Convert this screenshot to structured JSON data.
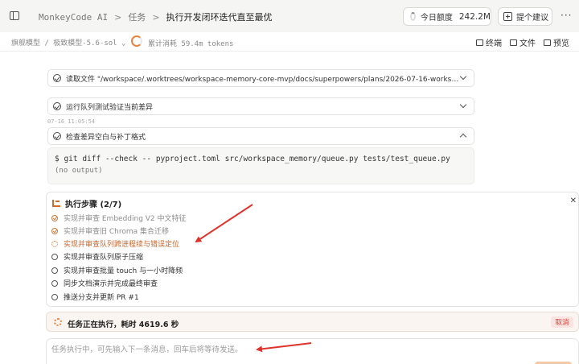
{
  "header": {
    "app_title": "MonkeyCode AI",
    "breadcrumb_section": "任务",
    "breadcrumb_current": "执行开发闭环迭代直至最优",
    "quota_label": "今日额度",
    "quota_value": "242.2M",
    "suggest_label": "提个建议",
    "more_label": "···"
  },
  "subbar": {
    "model_select": "旗舰模型 / 极致模型-5.6-sol ⌄",
    "token_usage": "累计消耗 59.4m tokens",
    "tools": [
      "终端",
      "文件",
      "预览"
    ]
  },
  "tool_cards": [
    {
      "text": "读取文件 \"/workspace/.worktrees/workspace-memory-core-mvp/docs/superpowers/plans/2026-07-16-works…",
      "expanded": false
    },
    {
      "text": "运行队列测试验证当前差异",
      "expanded": false
    },
    {
      "text": "检查差异空白与补丁格式",
      "expanded": true
    }
  ],
  "timestamp": "07-16 11:05:54",
  "output": {
    "command": "$ git diff --check -- pyproject.toml src/workspace_memory/queue.py tests/test_queue.py",
    "result": "(no output)"
  },
  "steps_panel": {
    "title": "执行步骤 (2/7)",
    "close_label": "✕",
    "items": [
      {
        "label": "实现并审查 Embedding V2 中文特征",
        "status": "done"
      },
      {
        "label": "实现并审查旧 Chroma 集合迁移",
        "status": "done"
      },
      {
        "label": "实现并审查队列跨进程续与错误定位",
        "status": "active"
      },
      {
        "label": "实现并审查队列原子压缩",
        "status": "pending"
      },
      {
        "label": "实现并审查批量 touch 与一小时降频",
        "status": "pending"
      },
      {
        "label": "同步文档演示并完成最终审查",
        "status": "pending"
      },
      {
        "label": "推送分支并更新 PR #1",
        "status": "pending"
      }
    ]
  },
  "running": {
    "text": "任务正在执行，耗时 4619.6 秒",
    "cancel_label": "取消"
  },
  "composer": {
    "placeholder": "任务执行中，可先输入下一条消息，回车后将等待发送。"
  },
  "colors": {
    "accent": "#d06a27",
    "danger": "#d84436",
    "annotation": "#e0322a"
  }
}
